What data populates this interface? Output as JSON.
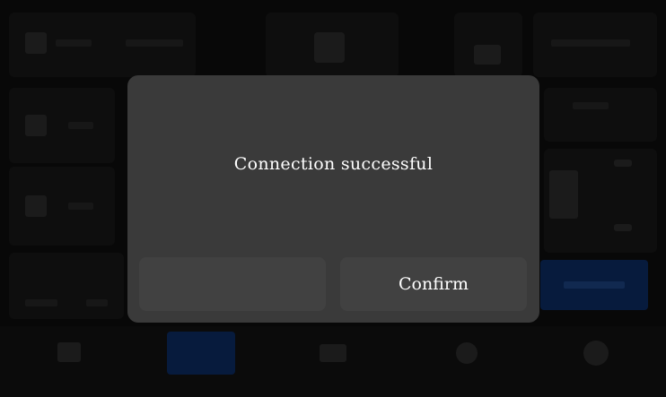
{
  "dialog": {
    "message": "Connection successful",
    "cancel_label": "",
    "confirm_label": "Confirm"
  },
  "colors": {
    "dialog_background": "#3a3a3a",
    "dialog_button": "#414141",
    "dialog_text": "#ffffff",
    "background_accent": "#0b2a5e"
  }
}
